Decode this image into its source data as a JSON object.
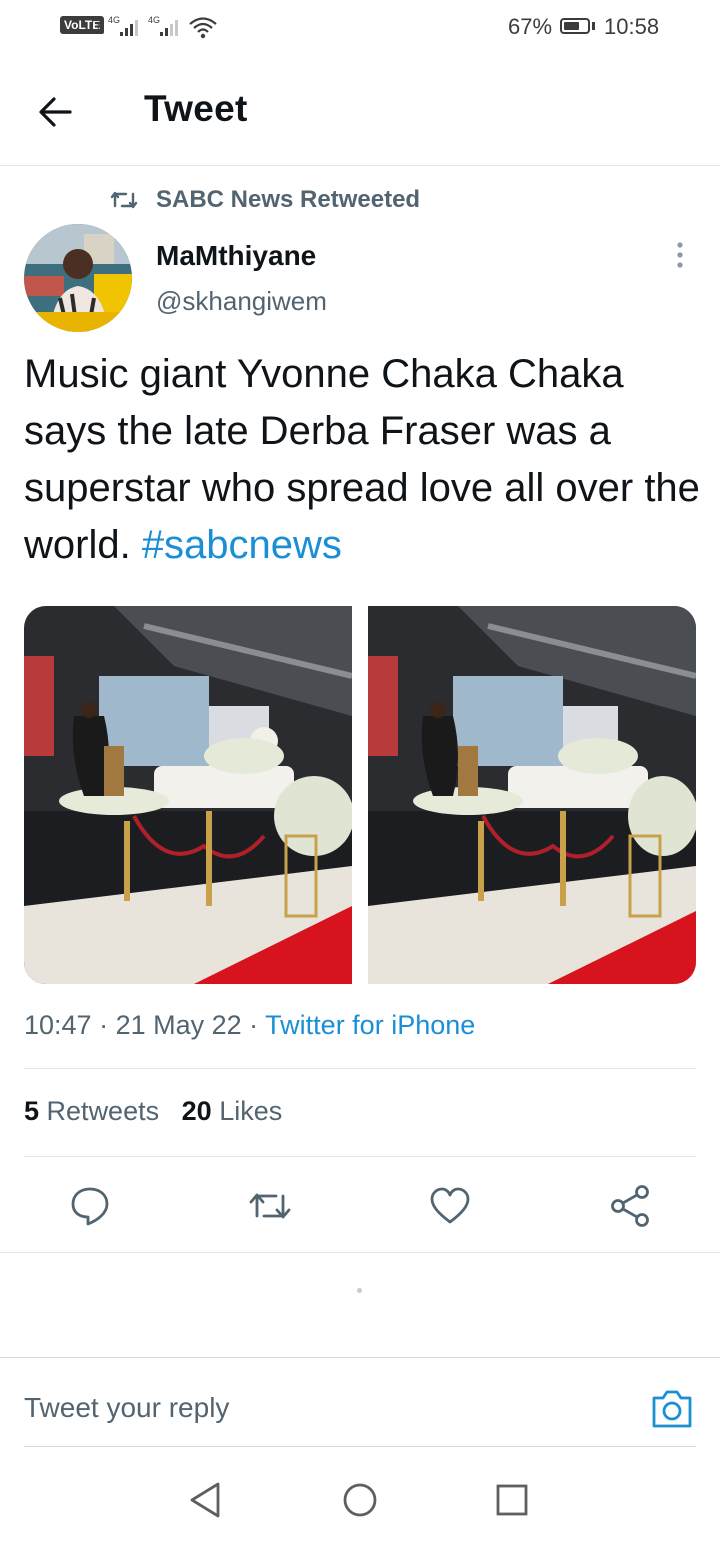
{
  "status_bar": {
    "volte": "VoLTE",
    "sim": "1",
    "net1": "4G",
    "net2": "4G",
    "battery_text": "67%",
    "battery_level": 0.67,
    "time": "10:58"
  },
  "header": {
    "title": "Tweet",
    "back_icon": "arrow-left-icon"
  },
  "tweet": {
    "retweeted_by": "SABC News Retweeted",
    "author_name": "MaMthiyane",
    "author_handle": "@skhangiwem",
    "text": "Music giant Yvonne Chaka Chaka says the late Derba Fraser was a superstar who spread love all over the world. ",
    "hashtag": "#sabcnews",
    "time": "10:47",
    "date": "21 May 22",
    "source": "Twitter for iPhone",
    "retweets_count": "5",
    "retweets_label": "Retweets",
    "likes_count": "20",
    "likes_label": "Likes"
  },
  "actions": [
    "reply-icon",
    "retweet-icon",
    "like-icon",
    "share-icon"
  ],
  "reply_bar": {
    "placeholder": "Tweet your reply",
    "camera_icon": "camera-icon"
  },
  "nav": [
    "back-triangle-icon",
    "home-circle-icon",
    "recents-square-icon"
  ],
  "colors": {
    "link": "#1b8fd6",
    "secondary_text": "#536471",
    "primary_text": "#0f1419",
    "divider": "#e1e6ea"
  }
}
